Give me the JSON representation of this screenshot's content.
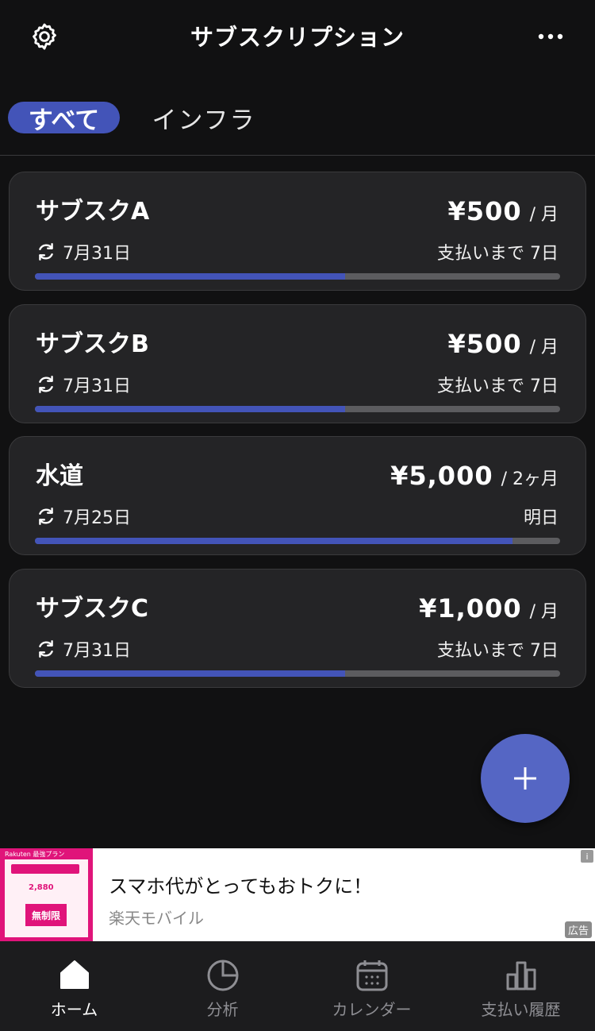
{
  "header": {
    "title": "サブスクリプション",
    "settings_icon": "gear-icon",
    "more_icon": "more-horizontal-icon"
  },
  "tabs": [
    {
      "label": "すべて",
      "active": true
    },
    {
      "label": "インフラ",
      "active": false
    }
  ],
  "subscriptions": [
    {
      "name": "サブスクA",
      "price": "¥500",
      "period": "/ 月",
      "date": "7月31日",
      "due": "支払いまで 7日",
      "progress": 0.59
    },
    {
      "name": "サブスクB",
      "price": "¥500",
      "period": "/ 月",
      "date": "7月31日",
      "due": "支払いまで 7日",
      "progress": 0.59
    },
    {
      "name": "水道",
      "price": "¥5,000",
      "period": "/ 2ヶ月",
      "date": "7月25日",
      "due": "明日",
      "progress": 0.91
    },
    {
      "name": "サブスクC",
      "price": "¥1,000",
      "period": "/ 月",
      "date": "7月31日",
      "due": "支払いまで 7日",
      "progress": 0.59
    }
  ],
  "fab": {
    "icon": "plus-icon"
  },
  "ad": {
    "headline": "スマホ代がとってもおトクに！",
    "sponsor": "楽天モバイル",
    "label": "広告",
    "info": "i",
    "thumb": {
      "brand": "Rakuten 最強プラン",
      "price": "2,880",
      "badge": "無制限"
    }
  },
  "nav": [
    {
      "label": "ホーム",
      "icon": "home-icon",
      "active": true
    },
    {
      "label": "分析",
      "icon": "pie-chart-icon",
      "active": false
    },
    {
      "label": "カレンダー",
      "icon": "calendar-icon",
      "active": false
    },
    {
      "label": "支払い履歴",
      "icon": "bar-chart-icon",
      "active": false
    }
  ],
  "colors": {
    "background": "#111112",
    "card": "#242426",
    "accent": "#4354b8",
    "fab": "#5566c4",
    "track": "#5c5c5f"
  }
}
